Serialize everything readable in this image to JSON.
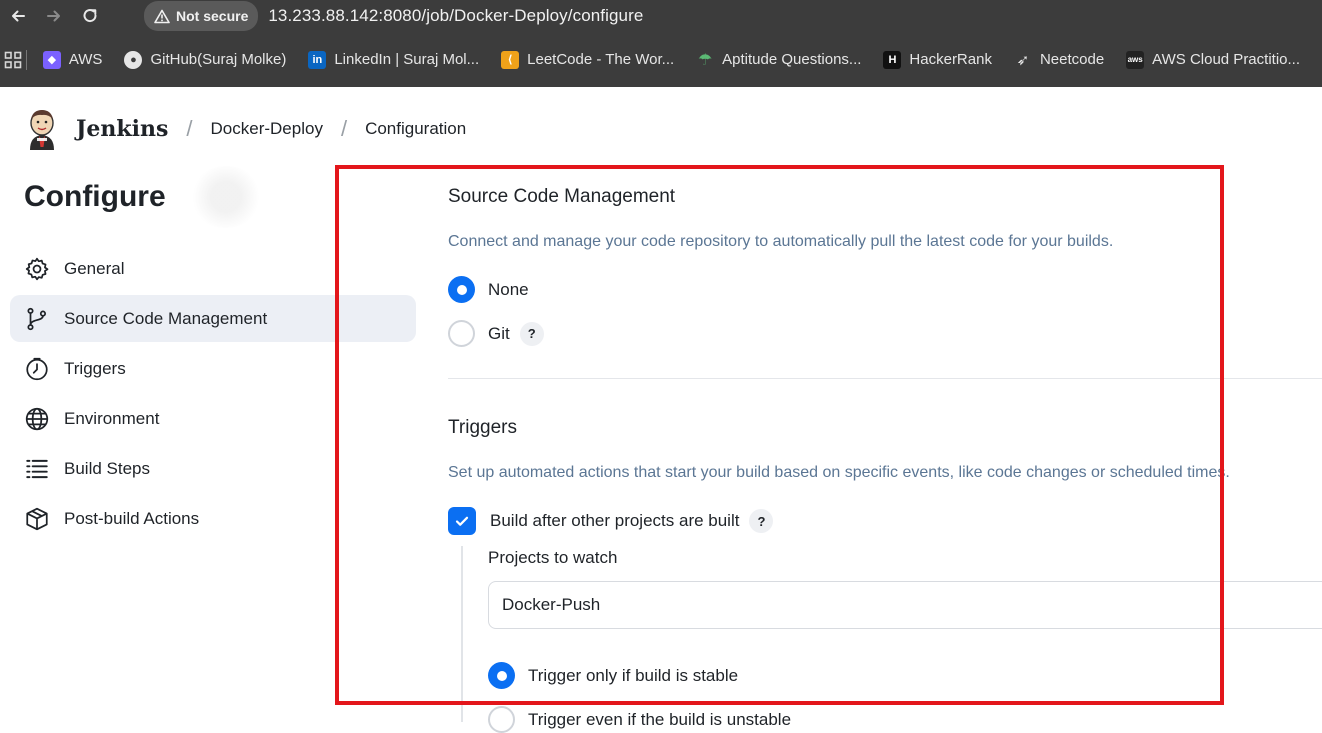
{
  "browser": {
    "security_label": "Not secure",
    "url": "13.233.88.142:8080/job/Docker-Deploy/configure",
    "nav_icons": [
      "back-arrow-icon",
      "forward-arrow-icon",
      "reload-icon"
    ],
    "bookmarks": [
      {
        "label": "AWS",
        "icon": "aws-cube-icon",
        "color": "#7b61ff"
      },
      {
        "label": "GitHub(Suraj Molke)",
        "icon": "github-icon",
        "color": "#2b2b2b"
      },
      {
        "label": "LinkedIn | Suraj Mol...",
        "icon": "linkedin-icon",
        "color": "#0a66c2"
      },
      {
        "label": "LeetCode - The Wor...",
        "icon": "leetcode-icon",
        "color": "#f0a21a"
      },
      {
        "label": "Aptitude Questions...",
        "icon": "aptitude-icon",
        "color": "#5bb974"
      },
      {
        "label": "HackerRank",
        "icon": "hackerrank-icon",
        "color": "#111111"
      },
      {
        "label": "Neetcode",
        "icon": "rocket-icon",
        "color": "#e8e8e8"
      },
      {
        "label": "AWS Cloud Practitio...",
        "icon": "aws-icon",
        "color": "#222222"
      }
    ]
  },
  "header": {
    "app_name": "Jenkins",
    "breadcrumbs": [
      "Docker-Deploy",
      "Configuration"
    ]
  },
  "sidebar": {
    "title": "Configure",
    "items": [
      {
        "label": "General",
        "icon": "gear-icon",
        "active": false
      },
      {
        "label": "Source Code Management",
        "icon": "git-branch-icon",
        "active": true
      },
      {
        "label": "Triggers",
        "icon": "clock-icon",
        "active": false
      },
      {
        "label": "Environment",
        "icon": "globe-icon",
        "active": false
      },
      {
        "label": "Build Steps",
        "icon": "list-icon",
        "active": false
      },
      {
        "label": "Post-build Actions",
        "icon": "package-icon",
        "active": false
      }
    ]
  },
  "scm": {
    "title": "Source Code Management",
    "description": "Connect and manage your code repository to automatically pull the latest code for your builds.",
    "options": [
      {
        "label": "None",
        "selected": true
      },
      {
        "label": "Git",
        "selected": false
      }
    ]
  },
  "triggers": {
    "title": "Triggers",
    "description": "Set up automated actions that start your build based on specific events, like code changes or scheduled times.",
    "build_after_label": "Build after other projects are built",
    "build_after_checked": true,
    "projects_label": "Projects to watch",
    "projects_value": "Docker-Push",
    "stability_options": [
      {
        "label": "Trigger only if build is stable",
        "selected": true
      },
      {
        "label": "Trigger even if the build is unstable",
        "selected": false
      }
    ]
  },
  "help_label": "?",
  "colors": {
    "accent": "#0b6ff2",
    "highlight_box": "#e3161b",
    "description_text": "#5b7694",
    "chrome_bg": "#3c3c3c"
  }
}
